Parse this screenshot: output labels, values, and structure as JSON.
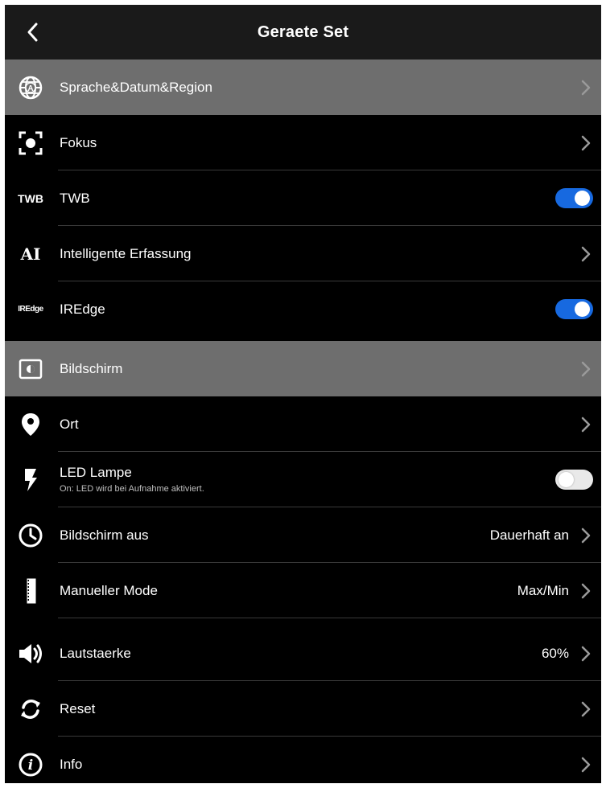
{
  "header": {
    "title": "Geraete Set"
  },
  "colors": {
    "background": "#000000",
    "highlight": "#6e6e6e",
    "toggle_on": "#1769e0",
    "toggle_off": "#e9e9e9",
    "separator": "#3a3a3a"
  },
  "rows": [
    {
      "label": "Sprache&Datum&Region",
      "icon": "globe-icon",
      "control": "chevron",
      "highlighted": true
    },
    {
      "label": "Fokus",
      "icon": "focus-icon",
      "control": "chevron"
    },
    {
      "label": "TWB",
      "icon_text": "TWB",
      "control": "toggle",
      "toggle_on": true
    },
    {
      "label": "Intelligente Erfassung",
      "icon_text": "AI",
      "control": "chevron"
    },
    {
      "label": "IREdge",
      "icon_text": "IREdge",
      "control": "toggle",
      "toggle_on": true
    },
    {
      "label": "Bildschirm",
      "icon": "display-icon",
      "control": "chevron",
      "highlighted": true
    },
    {
      "label": "Ort",
      "icon": "location-pin-icon",
      "control": "chevron"
    },
    {
      "label": "LED Lampe",
      "sublabel": "On: LED wird bei Aufnahme aktiviert.",
      "icon": "flash-icon",
      "control": "toggle",
      "toggle_on": false
    },
    {
      "label": "Bildschirm aus",
      "value": "Dauerhaft an",
      "icon": "clock-icon",
      "control": "chevron"
    },
    {
      "label": "Manueller Mode",
      "value": "Max/Min",
      "icon": "ruler-icon",
      "control": "chevron"
    },
    {
      "label": "Lautstaerke",
      "value": "60%",
      "icon": "speaker-icon",
      "control": "chevron"
    },
    {
      "label": "Reset",
      "icon": "reset-icon",
      "control": "chevron"
    },
    {
      "label": "Info",
      "icon": "info-icon",
      "control": "chevron"
    }
  ]
}
